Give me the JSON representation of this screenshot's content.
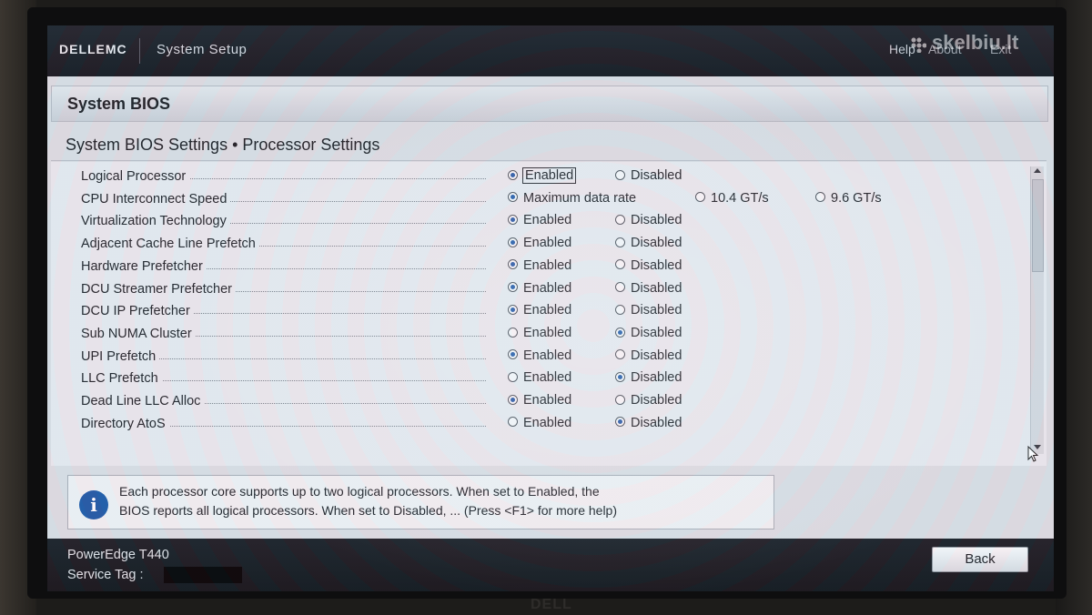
{
  "topbar": {
    "logo": "DELLEMC",
    "title": "System Setup",
    "help": "Help",
    "about": "About",
    "exit": "Exit",
    "watermark": "skelbiu.lt"
  },
  "bios_header": "System BIOS",
  "section_title": "System BIOS Settings • Processor Settings",
  "settings": [
    {
      "label": "Logical Processor",
      "options": [
        "Enabled",
        "Disabled"
      ],
      "selected": 0,
      "focused": true
    },
    {
      "label": "CPU Interconnect Speed",
      "options": [
        "Maximum data rate",
        "10.4 GT/s",
        "9.6 GT/s"
      ],
      "selected": 0
    },
    {
      "label": "Virtualization Technology",
      "options": [
        "Enabled",
        "Disabled"
      ],
      "selected": 0
    },
    {
      "label": "Adjacent Cache Line Prefetch",
      "options": [
        "Enabled",
        "Disabled"
      ],
      "selected": 0
    },
    {
      "label": "Hardware Prefetcher",
      "options": [
        "Enabled",
        "Disabled"
      ],
      "selected": 0
    },
    {
      "label": "DCU Streamer Prefetcher",
      "options": [
        "Enabled",
        "Disabled"
      ],
      "selected": 0
    },
    {
      "label": "DCU IP Prefetcher",
      "options": [
        "Enabled",
        "Disabled"
      ],
      "selected": 0
    },
    {
      "label": "Sub NUMA Cluster",
      "options": [
        "Enabled",
        "Disabled"
      ],
      "selected": 1
    },
    {
      "label": "UPI Prefetch",
      "options": [
        "Enabled",
        "Disabled"
      ],
      "selected": 0
    },
    {
      "label": "LLC Prefetch",
      "options": [
        "Enabled",
        "Disabled"
      ],
      "selected": 1
    },
    {
      "label": "Dead Line LLC Alloc",
      "options": [
        "Enabled",
        "Disabled"
      ],
      "selected": 0
    },
    {
      "label": "Directory AtoS",
      "options": [
        "Enabled",
        "Disabled"
      ],
      "selected": 1
    }
  ],
  "help": {
    "line1": "Each processor core supports up to two logical processors. When set to Enabled, the",
    "line2": "BIOS reports all logical processors. When set to Disabled, ... (Press <F1> for more help)",
    "icon": "info-icon"
  },
  "footer": {
    "model": "PowerEdge T440",
    "service_tag_label": "Service Tag :",
    "back_label": "Back"
  },
  "bezel_brand": "DELL",
  "colors": {
    "radio_selected": "#2a5fa8",
    "bar_dark": "#161a20",
    "panel_bg": "#e6e9ed"
  }
}
